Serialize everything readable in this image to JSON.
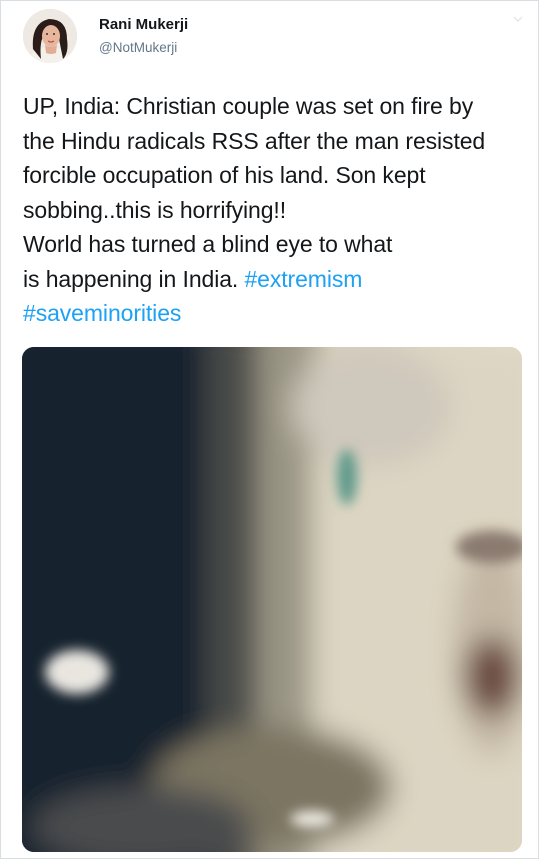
{
  "user": {
    "display_name": "Rani Mukerji",
    "handle": "@NotMukerji"
  },
  "tweet": {
    "lines": [
      "UP, India: Christian couple was set on fire by",
      "the Hindu radicals RSS after the man resisted",
      "forcible occupation of his land. Son kept",
      "sobbing..this is horrifying!!",
      "World has turned a blind eye to what"
    ],
    "line6_text": "is happening in India. ",
    "hashtag_1": "#extremism",
    "hashtag_2": "#saveminorities"
  },
  "icons": {
    "avatar": "profile-photo",
    "menu": "chevron-down-icon"
  },
  "colors": {
    "hashtag": "#1da1f2",
    "handle": "#657786",
    "text": "#14171a"
  }
}
